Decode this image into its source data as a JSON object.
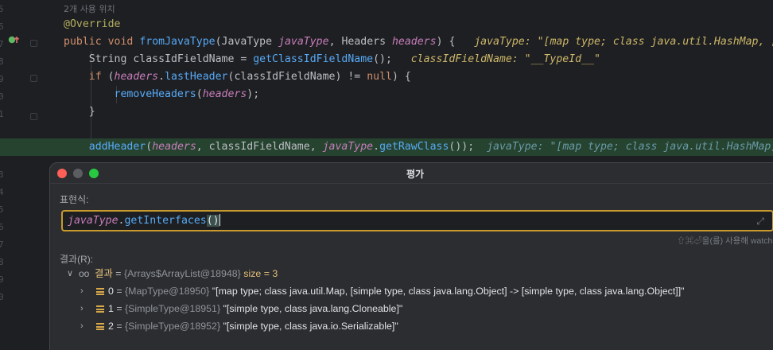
{
  "editor": {
    "usage_hint": "2개 사용 위치",
    "line_numbers": [
      "5",
      "6",
      "7",
      "8",
      "9",
      "0",
      "1",
      "2",
      "3",
      "4",
      "5",
      "6",
      "7",
      "8",
      "9",
      "0"
    ],
    "lines": {
      "annotation": "@Override",
      "l2_kw1": "public",
      "l2_kw2": "void",
      "l2_fn": "fromJavaType",
      "l2_p1type": "JavaType",
      "l2_p1": "javaType",
      "l2_p2type": "Headers",
      "l2_p2": "headers",
      "l2_inline": "javaType: \"[map type; class java.util.HashMap, [si",
      "l3_type": "String",
      "l3_var": "classIdFieldName",
      "l3_call": "getClassIdFieldName",
      "l3_inline": "classIdFieldName: \"__TypeId__\"",
      "l4_kw": "if",
      "l4_obj": "headers",
      "l4_call": "lastHeader",
      "l4_arg": "classIdFieldName",
      "l4_null": "null",
      "l5_call": "removeHeaders",
      "l5_arg": "headers",
      "l7_call": "addHeader",
      "l7_arg1": "headers",
      "l7_arg2": "classIdFieldName",
      "l7_arg3obj": "javaType",
      "l7_arg3call": "getRawClass",
      "l7_inline": "javaType: \"[map type; class java.util.HashMap,"
    }
  },
  "dialog": {
    "title": "평가",
    "expression_label": "표현식:",
    "expression_obj": "javaType",
    "expression_call": "getInterfaces",
    "hint": "⇧⌘⏎을(를) 사용해 watch에",
    "result_label": "결과(R):",
    "result": {
      "name": "결과",
      "value": "{Arrays$ArrayList@18948}",
      "size": "size = 3",
      "children": [
        {
          "index": "0",
          "ref": "{MapType@18950}",
          "value": "\"[map type; class java.util.Map, [simple type, class java.lang.Object] -> [simple type, class java.lang.Object]]\""
        },
        {
          "index": "1",
          "ref": "{SimpleType@18951}",
          "value": "\"[simple type, class java.lang.Cloneable]\""
        },
        {
          "index": "2",
          "ref": "{SimpleType@18952}",
          "value": "\"[simple type, class java.io.Serializable]\""
        }
      ]
    }
  },
  "colors": {
    "accent_border": "#c99a2e",
    "execution_line": "#26432f",
    "breakpoint": "#c94f4f",
    "close_button": "#ff5f57",
    "zoom_button": "#28c840"
  }
}
